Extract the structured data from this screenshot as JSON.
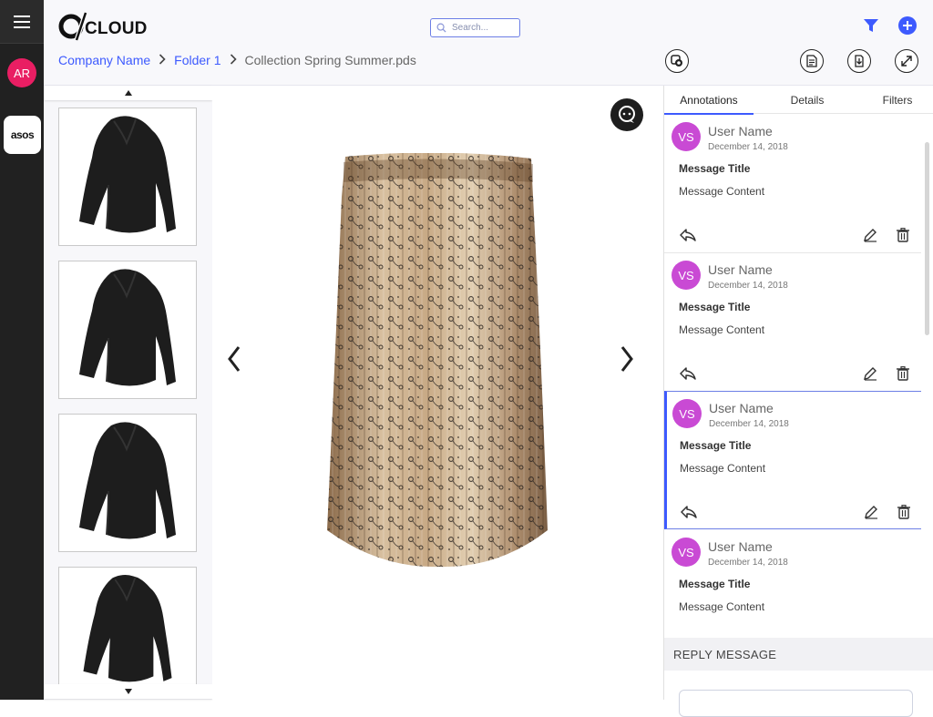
{
  "rail": {
    "avatar_initials": "AR",
    "brand_label": "asos"
  },
  "header": {
    "logo_text": "CLOUD",
    "search_placeholder": "Search...",
    "accent_color": "#3d5afe"
  },
  "breadcrumb": {
    "items": [
      "Company Name",
      "Folder 1"
    ],
    "current": "Collection Spring Summer.pds"
  },
  "toolbar": {
    "icons": [
      "copy-circle-icon",
      "document-icon",
      "download-icon",
      "expand-icon"
    ]
  },
  "thumbnails": {
    "items": [
      "sweater-thumbnail",
      "sweater-thumbnail",
      "sweater-thumbnail",
      "sweater-thumbnail"
    ]
  },
  "panel": {
    "tabs": [
      {
        "label": "Annotations"
      },
      {
        "label": "Details"
      },
      {
        "label": "Filters"
      }
    ],
    "annotations": [
      {
        "initials": "VS",
        "user": "User Name",
        "date": "December 14, 2018",
        "title": "Message Title",
        "content": "Message Content"
      },
      {
        "initials": "VS",
        "user": "User Name",
        "date": "December 14, 2018",
        "title": "Message Title",
        "content": "Message Content"
      },
      {
        "initials": "VS",
        "user": "User Name",
        "date": "December 14, 2018",
        "title": "Message Title",
        "content": "Message Content"
      },
      {
        "initials": "VS",
        "user": "User Name",
        "date": "December 14, 2018",
        "title": "Message Title",
        "content": "Message Content"
      }
    ],
    "reply_header": "REPLY MESSAGE"
  }
}
